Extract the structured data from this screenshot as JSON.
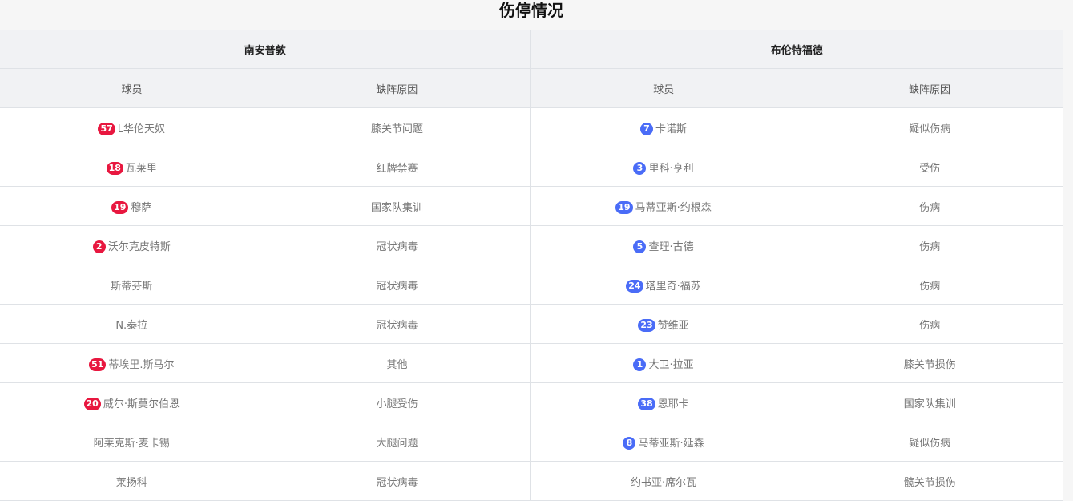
{
  "title": "伤停情况",
  "home_team": {
    "name": "南安普敦",
    "badge_color": "#e8173f"
  },
  "away_team": {
    "name": "布伦特福德",
    "badge_color": "#4a6cf7"
  },
  "columns": {
    "player": "球员",
    "reason": "缺阵原因"
  },
  "rows": [
    {
      "home_number": "57",
      "home_player": "L华伦天奴",
      "home_reason": "膝关节问题",
      "away_number": "7",
      "away_player": "卡诺斯",
      "away_reason": "疑似伤病"
    },
    {
      "home_number": "18",
      "home_player": "瓦莱里",
      "home_reason": "红牌禁赛",
      "away_number": "3",
      "away_player": "里科·亨利",
      "away_reason": "受伤"
    },
    {
      "home_number": "19",
      "home_player": "穆萨",
      "home_reason": "国家队集训",
      "away_number": "19",
      "away_player": "马蒂亚斯·约根森",
      "away_reason": "伤病"
    },
    {
      "home_number": "2",
      "home_player": "沃尔克皮特斯",
      "home_reason": "冠状病毒",
      "away_number": "5",
      "away_player": "查理·古德",
      "away_reason": "伤病"
    },
    {
      "home_number": "",
      "home_player": "斯蒂芬斯",
      "home_reason": "冠状病毒",
      "away_number": "24",
      "away_player": "塔里奇·福苏",
      "away_reason": "伤病"
    },
    {
      "home_number": "",
      "home_player": "N.泰拉",
      "home_reason": "冠状病毒",
      "away_number": "23",
      "away_player": "赞维亚",
      "away_reason": "伤病"
    },
    {
      "home_number": "51",
      "home_player": "蒂埃里.斯马尔",
      "home_reason": "其他",
      "away_number": "1",
      "away_player": "大卫·拉亚",
      "away_reason": "膝关节损伤"
    },
    {
      "home_number": "20",
      "home_player": "威尔·斯莫尔伯恩",
      "home_reason": "小腿受伤",
      "away_number": "38",
      "away_player": "恩耶卡",
      "away_reason": "国家队集训"
    },
    {
      "home_number": "",
      "home_player": "阿莱克斯·麦卡锡",
      "home_reason": "大腿问题",
      "away_number": "8",
      "away_player": "马蒂亚斯·延森",
      "away_reason": "疑似伤病"
    },
    {
      "home_number": "",
      "home_player": "莱扬科",
      "home_reason": "冠状病毒",
      "away_number": "",
      "away_player": "约书亚·席尔瓦",
      "away_reason": "髋关节损伤"
    }
  ]
}
